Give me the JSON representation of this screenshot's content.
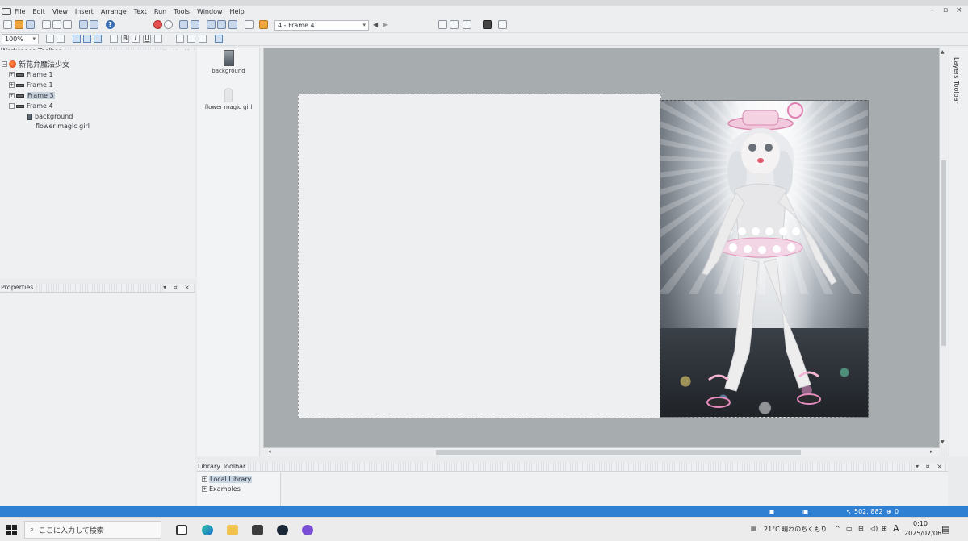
{
  "menu": {
    "items": [
      "File",
      "Edit",
      "View",
      "Insert",
      "Arrange",
      "Text",
      "Run",
      "Tools",
      "Window",
      "Help"
    ]
  },
  "toolbar": {
    "frame_select_value": "4 - Frame 4",
    "zoom_value": "100%"
  },
  "workspace": {
    "title": "Workspace Toolbar",
    "root_label": "新花弁魔法少女",
    "frames": [
      {
        "label": "Frame 1",
        "selected": false
      },
      {
        "label": "Frame 1",
        "selected": false
      },
      {
        "label": "Frame 3",
        "selected": true
      },
      {
        "label": "Frame 4",
        "selected": false
      }
    ],
    "layers": [
      {
        "label": "background"
      },
      {
        "label": "flower magic girl"
      }
    ]
  },
  "properties": {
    "title": "Properties"
  },
  "assets": [
    {
      "label": "background"
    },
    {
      "label": "flower magic girl"
    }
  ],
  "layers_toolbar": {
    "title": "Layers Toolbar"
  },
  "library": {
    "title": "Library Toolbar",
    "items": [
      {
        "label": "Local Library",
        "selected": true
      },
      {
        "label": "Examples",
        "selected": false
      }
    ]
  },
  "statusbar": {
    "coords": "502, 882",
    "count": "0"
  },
  "taskbar": {
    "search_placeholder": "ここに入力して検索",
    "weather": "21°C  晴れのちくもり",
    "ime": "A",
    "time": "0:10",
    "date": "2025/07/06"
  },
  "colors": {
    "statusbar": "#2f7fd3",
    "stage_bg": "#a7adae",
    "canvas": "#eeeff0"
  }
}
